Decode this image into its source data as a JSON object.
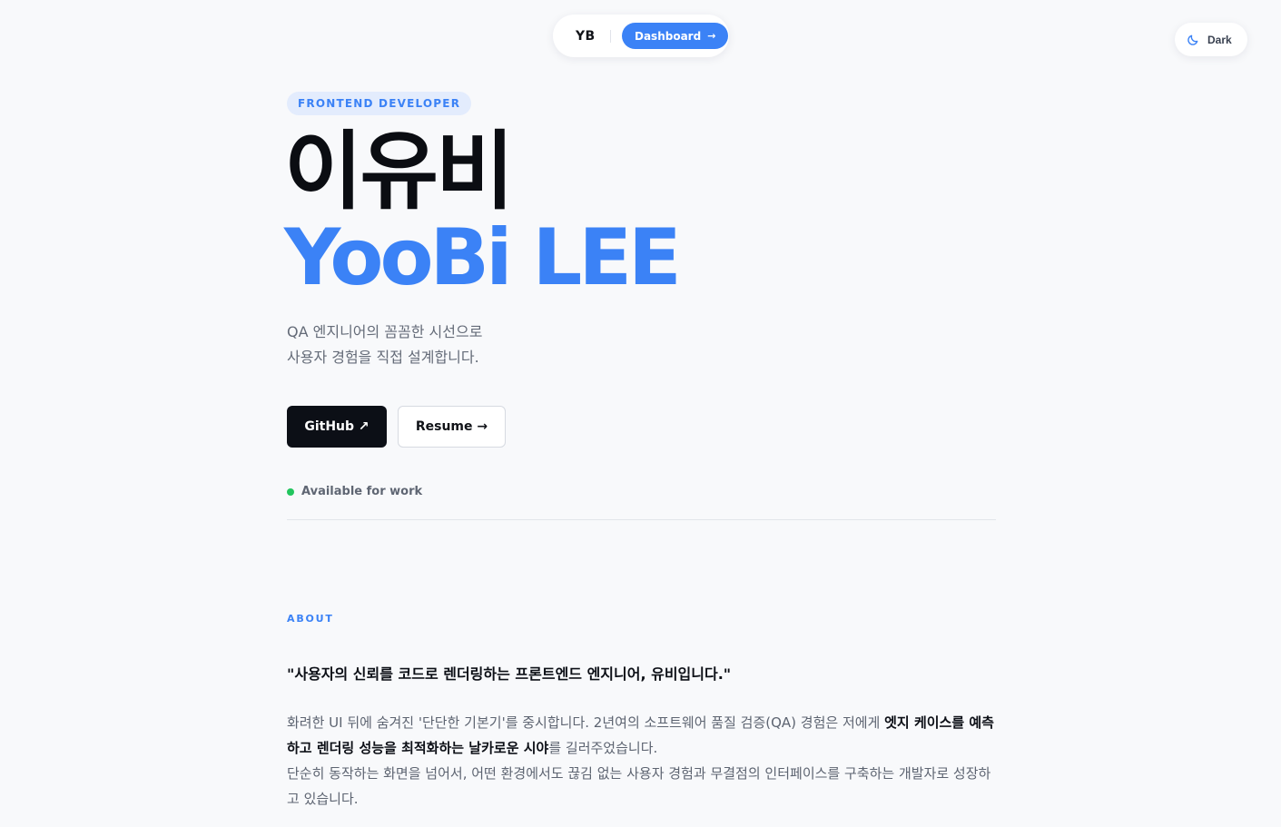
{
  "nav": {
    "logo": "YB",
    "dashboard_label": "Dashboard",
    "dashboard_icon": "arrow-right-icon"
  },
  "theme_toggle": {
    "label": "Dark",
    "icon": "moon-icon"
  },
  "hero": {
    "role_badge": "FRONTEND DEVELOPER",
    "name_ko": "이유비",
    "name_en": "YooBi LEE",
    "intro_line1": "QA 엔지니어의 꼼꼼한 시선으로",
    "intro_line2": "사용자 경험을 직접 설계합니다.",
    "github_label": "GitHub ↗",
    "resume_label": "Resume →",
    "status_text": "Available for work"
  },
  "about": {
    "heading": "ABOUT",
    "quote": "\"사용자의 신뢰를 코드로 렌더링하는 프론트엔드 엔지니어, 유비입니다.\"",
    "p1_before": "화려한 UI 뒤에 숨겨진 '단단한 기본기'를 중시합니다. 2년여의 소프트웨어 품질 검증(QA) 경험은 저에게 ",
    "p1_bold": "엣지 케이스를 예측하고 렌더링 성능을 최적화하는 날카로운 시야",
    "p1_after": "를 길러주었습니다.",
    "p2": "단순히 동작하는 화면을 넘어서, 어떤 환경에서도 끊김 없는 사용자 경험과 무결점의 인터페이스를 구축하는 개발자로 성장하고 있습니다."
  },
  "colors": {
    "accent": "#3b82f6",
    "background": "#f8f9fb",
    "status_green": "#22c55e",
    "dark_button": "#0c0f16"
  }
}
